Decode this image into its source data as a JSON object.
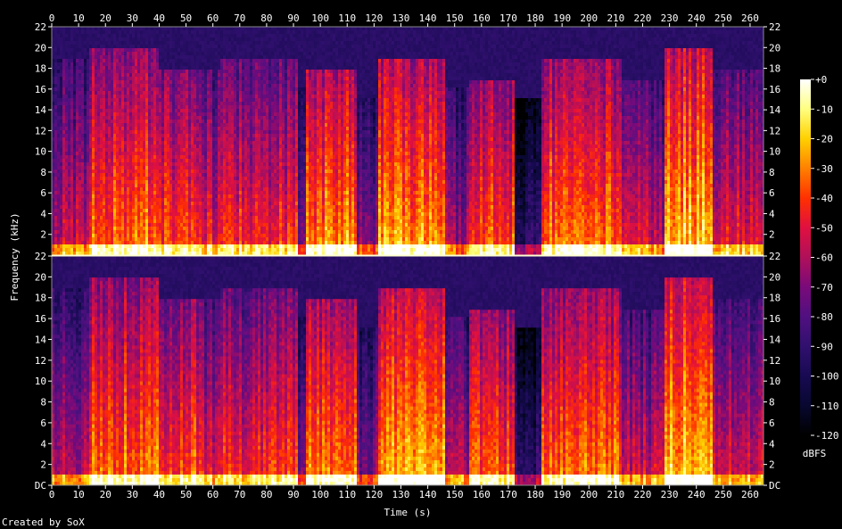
{
  "chart_data": {
    "type": "heatmap",
    "title": "",
    "xlabel": "Time (s)",
    "ylabel": "Frequency (kHz)",
    "credit": "Created by SoX",
    "channels": 2,
    "xlim": [
      0,
      265
    ],
    "ylim": [
      0,
      22
    ],
    "x_ticks": [
      0,
      10,
      20,
      30,
      40,
      50,
      60,
      70,
      80,
      90,
      100,
      110,
      120,
      130,
      140,
      150,
      160,
      170,
      180,
      190,
      200,
      210,
      220,
      230,
      240,
      250,
      260
    ],
    "y_ticks_top_channel": [
      "2",
      "4",
      "6",
      "8",
      "10",
      "12",
      "14",
      "16",
      "18",
      "20",
      "22"
    ],
    "y_ticks_bottom_channel": [
      "DC",
      "2",
      "4",
      "6",
      "8",
      "10",
      "12",
      "14",
      "16",
      "18",
      "20",
      "22"
    ],
    "y_tick_values": [
      0,
      2,
      4,
      6,
      8,
      10,
      12,
      14,
      16,
      18,
      20,
      22
    ],
    "colorbar": {
      "label": "dBFS",
      "range": [
        -120,
        0
      ],
      "ticks": [
        "+0",
        "-10",
        "-20",
        "-30",
        "-40",
        "-50",
        "-60",
        "-70",
        "-80",
        "-90",
        "-100",
        "-110",
        "-120"
      ],
      "colors": [
        "#ffffff",
        "#ffff80",
        "#ffd000",
        "#ff8000",
        "#ff3000",
        "#e01040",
        "#b0105a",
        "#7a0a7a",
        "#501080",
        "#30106e",
        "#180a52",
        "#080830",
        "#000000"
      ]
    },
    "segments": [
      {
        "t": [
          0,
          14
        ],
        "level": 0.55,
        "cutoff_khz": 19
      },
      {
        "t": [
          14,
          40
        ],
        "level": 0.75,
        "cutoff_khz": 20
      },
      {
        "t": [
          40,
          55
        ],
        "level": 0.7,
        "cutoff_khz": 18
      },
      {
        "t": [
          55,
          63
        ],
        "level": 0.6,
        "cutoff_khz": 18
      },
      {
        "t": [
          63,
          92
        ],
        "level": 0.65,
        "cutoff_khz": 19
      },
      {
        "t": [
          92,
          95
        ],
        "level": 0.4,
        "cutoff_khz": 16
      },
      {
        "t": [
          95,
          114
        ],
        "level": 0.78,
        "cutoff_khz": 18
      },
      {
        "t": [
          114,
          122
        ],
        "level": 0.45,
        "cutoff_khz": 15
      },
      {
        "t": [
          122,
          146
        ],
        "level": 0.8,
        "cutoff_khz": 19
      },
      {
        "t": [
          146,
          155
        ],
        "level": 0.5,
        "cutoff_khz": 16
      },
      {
        "t": [
          155,
          172
        ],
        "level": 0.7,
        "cutoff_khz": 17
      },
      {
        "t": [
          172,
          182
        ],
        "level": 0.25,
        "cutoff_khz": 15
      },
      {
        "t": [
          182,
          212
        ],
        "level": 0.75,
        "cutoff_khz": 19
      },
      {
        "t": [
          212,
          228
        ],
        "level": 0.55,
        "cutoff_khz": 17
      },
      {
        "t": [
          228,
          246
        ],
        "level": 0.85,
        "cutoff_khz": 20
      },
      {
        "t": [
          246,
          265
        ],
        "level": 0.6,
        "cutoff_khz": 18
      }
    ]
  }
}
